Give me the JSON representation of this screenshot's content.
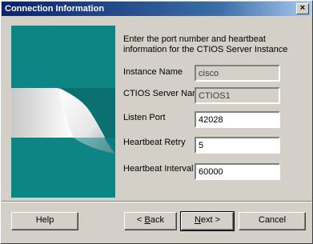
{
  "window": {
    "title": "Connection Information",
    "close_glyph": "×"
  },
  "intro": "Enter the port number and heartbeat information for the CTIOS Server Instance",
  "fields": {
    "instance_name": {
      "label": "Instance Name",
      "value": "cisco"
    },
    "server_name": {
      "label": "CTIOS Server Name",
      "value": "CTIOS1"
    },
    "listen_port": {
      "label": "Listen Port",
      "value": "42028"
    },
    "heartbeat_retry": {
      "label": "Heartbeat Retry",
      "value": "5"
    },
    "heartbeat_interval": {
      "label": "Heartbeat Interval",
      "value": "60000"
    }
  },
  "buttons": {
    "help": "Help",
    "back_prefix": "< ",
    "back_key": "B",
    "back_rest": "ack",
    "next_key": "N",
    "next_rest": "ext >",
    "cancel": "Cancel"
  },
  "colors": {
    "titlebar": "#0a246a",
    "art_panel": "#0e8585",
    "face": "#d4d0c8"
  }
}
